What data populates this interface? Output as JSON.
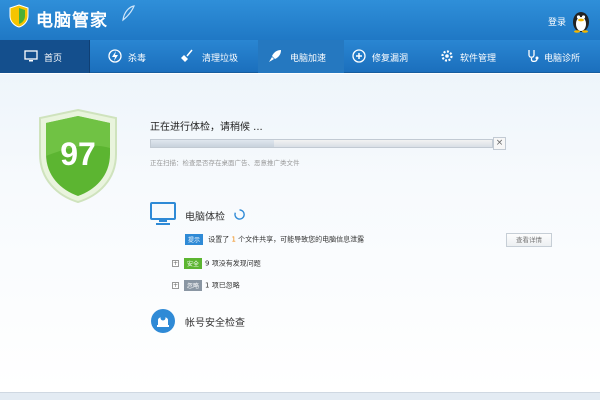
{
  "app": {
    "title": "电脑管家",
    "login": "登录"
  },
  "nav": {
    "tabs": [
      {
        "label": "首页",
        "icon": "monitor-icon"
      },
      {
        "label": "杀毒",
        "icon": "lightning-icon"
      },
      {
        "label": "清理垃圾",
        "icon": "broom-icon"
      },
      {
        "label": "电脑加速",
        "icon": "rocket-icon"
      },
      {
        "label": "修复漏洞",
        "icon": "patch-icon"
      },
      {
        "label": "软件管理",
        "icon": "gear-icon"
      },
      {
        "label": "电脑诊所",
        "icon": "stethoscope-icon"
      }
    ]
  },
  "main": {
    "score": "97",
    "checking_title": "正在进行体检，请稍候 ...",
    "progress": 0.36,
    "close_glyph": "×",
    "scan_status": "正在扫描：检查是否存在桌面广告、恶意推广类文件",
    "pc_check": {
      "title": "电脑体检",
      "rows": [
        {
          "tag": "提示",
          "tag_color": "#2f8ad6",
          "pre": "设置了 ",
          "count": "1",
          "post": " 个文件共享，可能导致您的电脑信息泄露"
        },
        {
          "tag": "安全",
          "tag_color": "#5cb531",
          "text": "9 项没有发现问题",
          "expand": "+"
        },
        {
          "tag": "忽略",
          "tag_color": "#8a96a3",
          "text": "1 项已忽略",
          "expand": "+"
        }
      ],
      "view_details": "查看详情"
    },
    "account_check": {
      "title": "帐号安全检查"
    }
  },
  "colors": {
    "brand": "#1f78c5",
    "accent_green": "#5cb531",
    "warn_orange": "#f08300"
  }
}
